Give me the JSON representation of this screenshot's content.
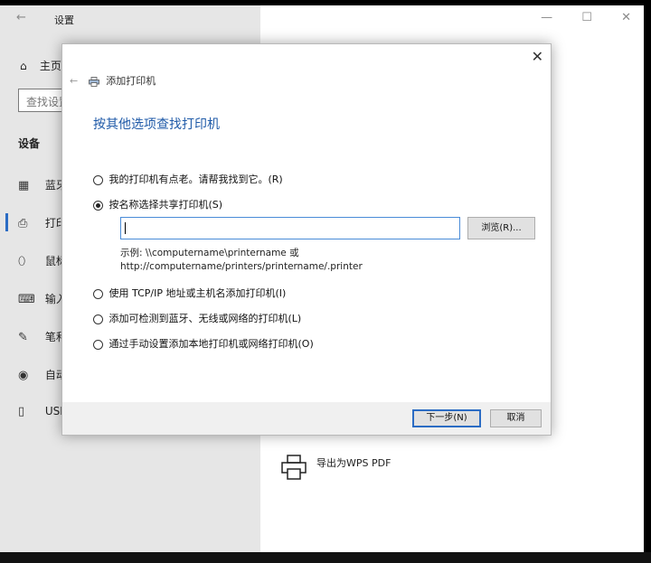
{
  "settings": {
    "back_glyph": "←",
    "title": "设置",
    "home_label": "主页",
    "search_placeholder": "查找设置",
    "section_title": "设备",
    "nav_items": [
      {
        "label": "蓝牙和其他设备",
        "icon": "bluetooth-devices-icon"
      },
      {
        "label": "打印机和扫描仪",
        "icon": "printer-icon"
      },
      {
        "label": "鼠标",
        "icon": "mouse-icon"
      },
      {
        "label": "输入",
        "icon": "keyboard-icon"
      },
      {
        "label": "笔和 Windows Ink",
        "icon": "pen-icon"
      },
      {
        "label": "自动播放",
        "icon": "autoplay-icon"
      },
      {
        "label": "USB",
        "icon": "usb-icon"
      }
    ],
    "window_controls": {
      "minimize": "—",
      "maximize": "☐",
      "close": "✕"
    },
    "export_pdf_label": "导出为WPS PDF",
    "accent_color": "#2b6cc4"
  },
  "dialog": {
    "close_glyph": "✕",
    "back_glyph": "←",
    "header_title": "添加打印机",
    "heading": "按其他选项查找打印机",
    "options": [
      {
        "label": "我的打印机有点老。请帮我找到它。(R)",
        "checked": false
      },
      {
        "label": "按名称选择共享打印机(S)",
        "checked": true
      },
      {
        "label": "使用 TCP/IP 地址或主机名添加打印机(I)",
        "checked": false
      },
      {
        "label": "添加可检测到蓝牙、无线或网络的打印机(L)",
        "checked": false
      },
      {
        "label": "通过手动设置添加本地打印机或网络打印机(O)",
        "checked": false
      }
    ],
    "share_input_value": "",
    "browse_label": "浏览(R)...",
    "example_line1": "示例: \\\\computername\\printername 或",
    "example_line2": "http://computername/printers/printername/.printer",
    "next_label": "下一步(N)",
    "cancel_label": "取消"
  }
}
